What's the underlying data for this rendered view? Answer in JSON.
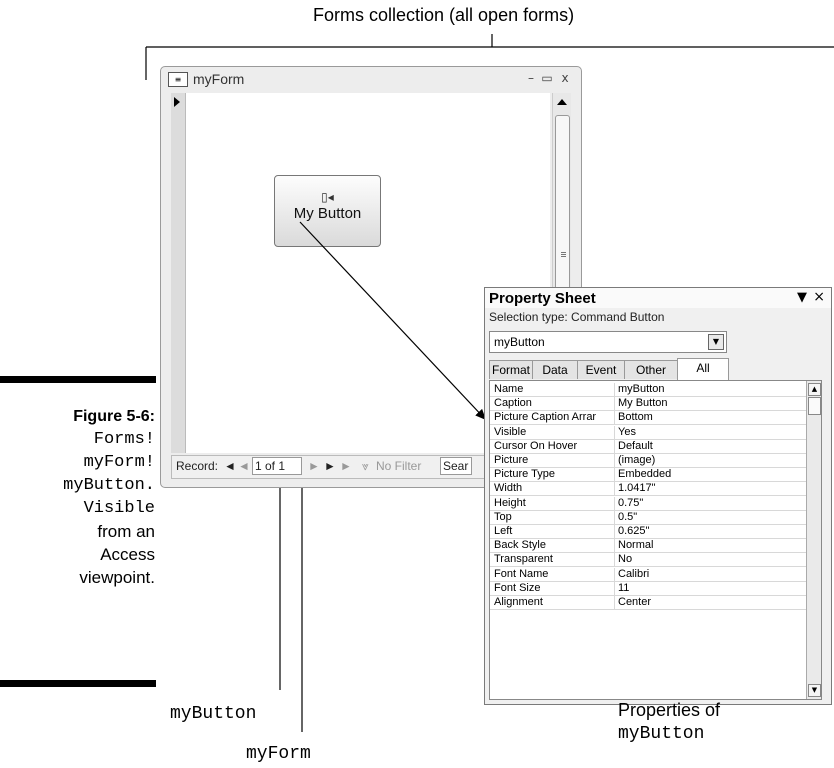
{
  "callouts": {
    "forms_collection": "Forms collection (all open forms)",
    "properties_of": "Properties of",
    "properties_of_target": "myButton",
    "mybutton": "myButton",
    "myform": "myForm"
  },
  "caption": {
    "figure": "Figure 5-6:",
    "line1": "Forms!",
    "line2": "myForm!",
    "line3": "myButton.",
    "line4": "Visible",
    "line5": "from an",
    "line6": "Access",
    "line7": "viewpoint."
  },
  "form_window": {
    "title": "myForm",
    "minimize": "–",
    "maximize": "▭",
    "close": "x",
    "button_label": "My Button",
    "nav": {
      "record_label": "Record:",
      "first": "◄",
      "prev": "◄",
      "position": "1 of 1",
      "next": "►",
      "last": "►",
      "new": "►",
      "filter": "No Filter",
      "search": "Sear"
    }
  },
  "property_sheet": {
    "title": "Property Sheet",
    "dropdown_glyph": "▼",
    "close_glyph": "×",
    "selection_type": "Selection type:  Command Button",
    "selected_object": "myButton",
    "tabs": [
      "Format",
      "Data",
      "Event",
      "Other",
      "All"
    ],
    "active_tab": "All",
    "properties": [
      {
        "name": "Name",
        "value": "myButton"
      },
      {
        "name": "Caption",
        "value": "My Button"
      },
      {
        "name": "Picture Caption Arrar",
        "value": "Bottom"
      },
      {
        "name": "Visible",
        "value": "Yes"
      },
      {
        "name": "Cursor On Hover",
        "value": "Default"
      },
      {
        "name": "Picture",
        "value": "(image)"
      },
      {
        "name": "Picture Type",
        "value": "Embedded"
      },
      {
        "name": "Width",
        "value": "1.0417\""
      },
      {
        "name": "Height",
        "value": "0.75\""
      },
      {
        "name": "Top",
        "value": "0.5\""
      },
      {
        "name": "Left",
        "value": "0.625\""
      },
      {
        "name": "Back Style",
        "value": "Normal"
      },
      {
        "name": "Transparent",
        "value": "No"
      },
      {
        "name": "Font Name",
        "value": "Calibri"
      },
      {
        "name": "Font Size",
        "value": "11"
      },
      {
        "name": "Alignment",
        "value": "Center"
      }
    ]
  },
  "icons": {
    "form_icon": "form-icon",
    "button_picture": "open-door-icon",
    "record_selector": "current-record-triangle-icon",
    "filter_icon": "funnel-icon"
  }
}
